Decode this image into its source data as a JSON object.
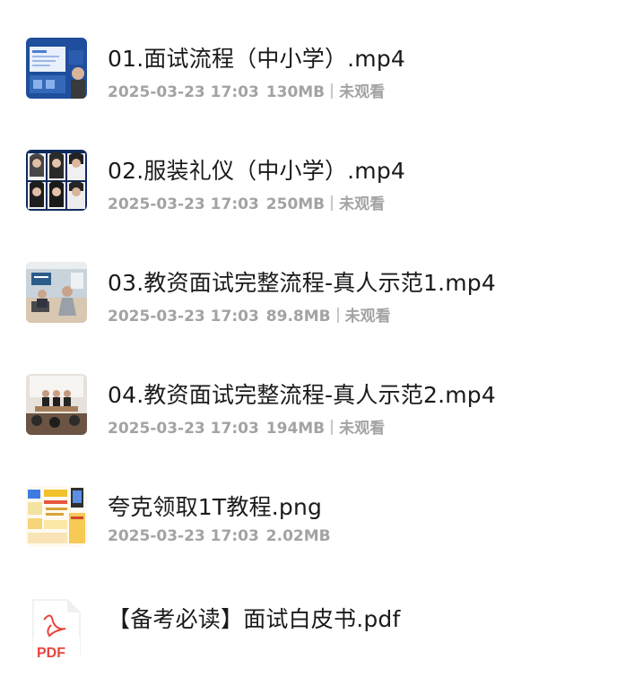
{
  "files": [
    {
      "name": "01.面试流程（中小学）.mp4",
      "date": "2025-03-23 17:03",
      "size": "130MB",
      "status": "未观看",
      "thumb_icon": "video-thumbnail-presentation"
    },
    {
      "name": "02.服装礼仪（中小学）.mp4",
      "date": "2025-03-23 17:03",
      "size": "250MB",
      "status": "未观看",
      "thumb_icon": "video-thumbnail-portraits"
    },
    {
      "name": "03.教资面试完整流程-真人示范1.mp4",
      "date": "2025-03-23 17:03",
      "size": "89.8MB",
      "status": "未观看",
      "thumb_icon": "video-thumbnail-classroom"
    },
    {
      "name": "04.教资面试完整流程-真人示范2.mp4",
      "date": "2025-03-23 17:03",
      "size": "194MB",
      "status": "未观看",
      "thumb_icon": "video-thumbnail-lecture"
    },
    {
      "name": "夸克领取1T教程.png",
      "date": "2025-03-23 17:03",
      "size": "2.02MB",
      "thumb_icon": "image-thumbnail-tutorial"
    },
    {
      "name": "【备考必读】面试白皮书.pdf",
      "thumb_icon": "pdf-file-icon",
      "thumb_label": "PDF"
    }
  ],
  "colors": {
    "title": "#1a1a1a",
    "meta": "#a3a3a3",
    "pdf_red": "#e8453c"
  }
}
